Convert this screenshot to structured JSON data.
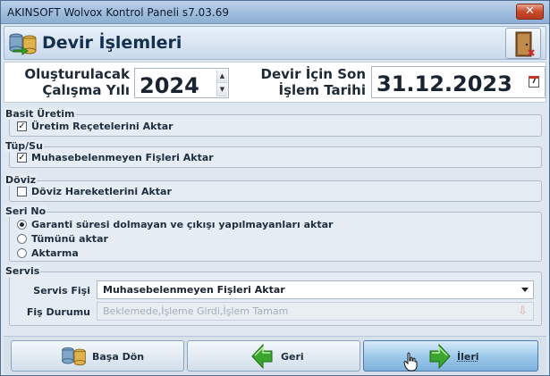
{
  "window": {
    "title": "AKINSOFT Wolvox Kontrol Paneli s7.03.69",
    "close_label": "✕"
  },
  "header": {
    "title": "Devir İşlemleri"
  },
  "top": {
    "year_label_line1": "Oluşturulacak",
    "year_label_line2": "Çalışma Yılı",
    "year_value": "2024",
    "date_label_line1": "Devir İçin Son",
    "date_label_line2": "İşlem Tarihi",
    "date_value": "31.12.2023",
    "calendar_day": "7"
  },
  "groups": {
    "basit_uretim": {
      "label": "Basit Üretim",
      "option": "Üretim Reçetelerini Aktar",
      "checked": true
    },
    "tup_su": {
      "label": "Tüp/Su",
      "option": "Muhasebelenmeyen Fişleri Aktar",
      "checked": true
    },
    "doviz": {
      "label": "Döviz",
      "option": "Döviz Hareketlerini Aktar",
      "checked": false
    },
    "seri_no": {
      "label": "Seri No",
      "options": [
        "Garanti süresi dolmayan ve çıkışı yapılmayanları aktar",
        "Tümünü aktar",
        "Aktarma"
      ],
      "selected_index": 0
    },
    "servis": {
      "label": "Servis",
      "servis_fisi_label": "Servis Fişi",
      "servis_fisi_value": "Muhasebelenmeyen Fişleri Aktar",
      "fis_durumu_label": "Fiş Durumu",
      "fis_durumu_value": "Beklemede,İşleme Girdi,İşlem Tamam"
    }
  },
  "buttons": {
    "back_to_start": "Başa Dön",
    "back": "Geri",
    "next": "İleri"
  },
  "check_mark": "✓",
  "colors": {
    "accent_green": "#3ca52e",
    "title_bar": "#9fbcdc",
    "active_button": "#9ec9ea"
  }
}
